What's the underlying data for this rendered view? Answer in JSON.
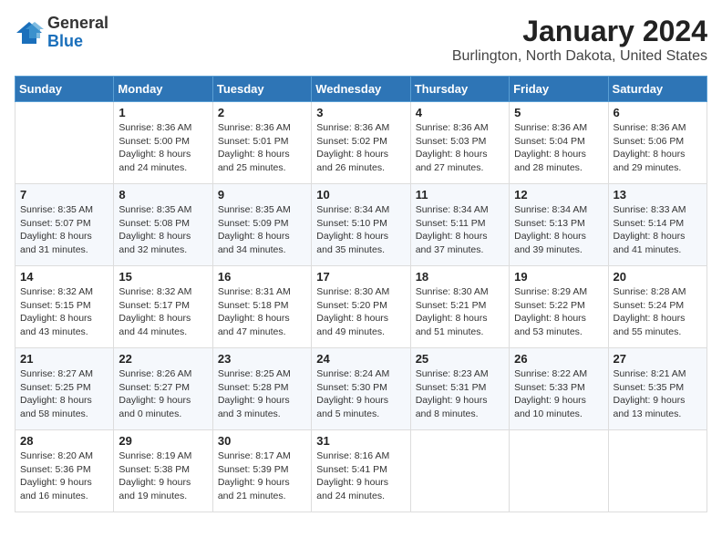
{
  "logo": {
    "general": "General",
    "blue": "Blue"
  },
  "title": "January 2024",
  "subtitle": "Burlington, North Dakota, United States",
  "days_header": [
    "Sunday",
    "Monday",
    "Tuesday",
    "Wednesday",
    "Thursday",
    "Friday",
    "Saturday"
  ],
  "weeks": [
    [
      {
        "num": "",
        "info": ""
      },
      {
        "num": "1",
        "info": "Sunrise: 8:36 AM\nSunset: 5:00 PM\nDaylight: 8 hours\nand 24 minutes."
      },
      {
        "num": "2",
        "info": "Sunrise: 8:36 AM\nSunset: 5:01 PM\nDaylight: 8 hours\nand 25 minutes."
      },
      {
        "num": "3",
        "info": "Sunrise: 8:36 AM\nSunset: 5:02 PM\nDaylight: 8 hours\nand 26 minutes."
      },
      {
        "num": "4",
        "info": "Sunrise: 8:36 AM\nSunset: 5:03 PM\nDaylight: 8 hours\nand 27 minutes."
      },
      {
        "num": "5",
        "info": "Sunrise: 8:36 AM\nSunset: 5:04 PM\nDaylight: 8 hours\nand 28 minutes."
      },
      {
        "num": "6",
        "info": "Sunrise: 8:36 AM\nSunset: 5:06 PM\nDaylight: 8 hours\nand 29 minutes."
      }
    ],
    [
      {
        "num": "7",
        "info": "Sunrise: 8:35 AM\nSunset: 5:07 PM\nDaylight: 8 hours\nand 31 minutes."
      },
      {
        "num": "8",
        "info": "Sunrise: 8:35 AM\nSunset: 5:08 PM\nDaylight: 8 hours\nand 32 minutes."
      },
      {
        "num": "9",
        "info": "Sunrise: 8:35 AM\nSunset: 5:09 PM\nDaylight: 8 hours\nand 34 minutes."
      },
      {
        "num": "10",
        "info": "Sunrise: 8:34 AM\nSunset: 5:10 PM\nDaylight: 8 hours\nand 35 minutes."
      },
      {
        "num": "11",
        "info": "Sunrise: 8:34 AM\nSunset: 5:11 PM\nDaylight: 8 hours\nand 37 minutes."
      },
      {
        "num": "12",
        "info": "Sunrise: 8:34 AM\nSunset: 5:13 PM\nDaylight: 8 hours\nand 39 minutes."
      },
      {
        "num": "13",
        "info": "Sunrise: 8:33 AM\nSunset: 5:14 PM\nDaylight: 8 hours\nand 41 minutes."
      }
    ],
    [
      {
        "num": "14",
        "info": "Sunrise: 8:32 AM\nSunset: 5:15 PM\nDaylight: 8 hours\nand 43 minutes."
      },
      {
        "num": "15",
        "info": "Sunrise: 8:32 AM\nSunset: 5:17 PM\nDaylight: 8 hours\nand 44 minutes."
      },
      {
        "num": "16",
        "info": "Sunrise: 8:31 AM\nSunset: 5:18 PM\nDaylight: 8 hours\nand 47 minutes."
      },
      {
        "num": "17",
        "info": "Sunrise: 8:30 AM\nSunset: 5:20 PM\nDaylight: 8 hours\nand 49 minutes."
      },
      {
        "num": "18",
        "info": "Sunrise: 8:30 AM\nSunset: 5:21 PM\nDaylight: 8 hours\nand 51 minutes."
      },
      {
        "num": "19",
        "info": "Sunrise: 8:29 AM\nSunset: 5:22 PM\nDaylight: 8 hours\nand 53 minutes."
      },
      {
        "num": "20",
        "info": "Sunrise: 8:28 AM\nSunset: 5:24 PM\nDaylight: 8 hours\nand 55 minutes."
      }
    ],
    [
      {
        "num": "21",
        "info": "Sunrise: 8:27 AM\nSunset: 5:25 PM\nDaylight: 8 hours\nand 58 minutes."
      },
      {
        "num": "22",
        "info": "Sunrise: 8:26 AM\nSunset: 5:27 PM\nDaylight: 9 hours\nand 0 minutes."
      },
      {
        "num": "23",
        "info": "Sunrise: 8:25 AM\nSunset: 5:28 PM\nDaylight: 9 hours\nand 3 minutes."
      },
      {
        "num": "24",
        "info": "Sunrise: 8:24 AM\nSunset: 5:30 PM\nDaylight: 9 hours\nand 5 minutes."
      },
      {
        "num": "25",
        "info": "Sunrise: 8:23 AM\nSunset: 5:31 PM\nDaylight: 9 hours\nand 8 minutes."
      },
      {
        "num": "26",
        "info": "Sunrise: 8:22 AM\nSunset: 5:33 PM\nDaylight: 9 hours\nand 10 minutes."
      },
      {
        "num": "27",
        "info": "Sunrise: 8:21 AM\nSunset: 5:35 PM\nDaylight: 9 hours\nand 13 minutes."
      }
    ],
    [
      {
        "num": "28",
        "info": "Sunrise: 8:20 AM\nSunset: 5:36 PM\nDaylight: 9 hours\nand 16 minutes."
      },
      {
        "num": "29",
        "info": "Sunrise: 8:19 AM\nSunset: 5:38 PM\nDaylight: 9 hours\nand 19 minutes."
      },
      {
        "num": "30",
        "info": "Sunrise: 8:17 AM\nSunset: 5:39 PM\nDaylight: 9 hours\nand 21 minutes."
      },
      {
        "num": "31",
        "info": "Sunrise: 8:16 AM\nSunset: 5:41 PM\nDaylight: 9 hours\nand 24 minutes."
      },
      {
        "num": "",
        "info": ""
      },
      {
        "num": "",
        "info": ""
      },
      {
        "num": "",
        "info": ""
      }
    ]
  ]
}
